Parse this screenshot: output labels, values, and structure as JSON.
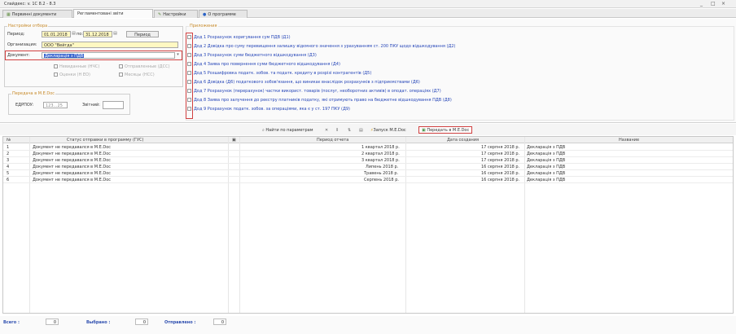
{
  "window": {
    "title": "Слайдекс: v. 1С 8.2 - 8.3",
    "controls": [
      "_",
      "□",
      "×"
    ]
  },
  "tabs": [
    {
      "label": "Первинні документи",
      "icon": "grid-icon",
      "active": false
    },
    {
      "label": "Регламентовані звіти",
      "icon": "",
      "active": true
    },
    {
      "label": "Настройки",
      "icon": "settings-icon",
      "active": false
    },
    {
      "label": "О программе",
      "icon": "info-icon",
      "active": false
    }
  ],
  "filter": {
    "group_title": "Настройки отбора",
    "period_label": "Период:",
    "period_from": "01.01.2018",
    "period_to_label": "по:",
    "period_to": "31.12.2018",
    "period_button": "Период",
    "org_label": "Организация:",
    "org_value": "ООО \"Вейгда\"",
    "doc_label": "Документ:",
    "doc_value": "Декларація з ПДВ",
    "opt1": "Невиданные (НЧС)",
    "opt2": "Отправленные (ДСС)",
    "opt3": "Оценки (Н ЕО)",
    "opt4": "Месяцы (НСС)"
  },
  "transfer": {
    "group_title": "Передача в M.E.Doc",
    "edrpou_label": "ЕДРПОУ:",
    "edrpou_value": "123…25",
    "period_label": "Звітний:"
  },
  "appendices": {
    "group_title": "Приложения",
    "items": [
      "Дод 1 Розрахунок коригування сум ПДВ (Д1)",
      "Дод 2 Довідка про суму перевищення залишку вiдємного значення з урахуванням ст. 200 ПКУ щодо відшкодування (Д2)",
      "Дод 3 Розрахунок суми бюджетного відшкодування (Д3)",
      "Дод 4 Заява про повернення суми бюджетного відшкодування (Д4)",
      "Дод 5 Розшифровка податк. зобов. та податк. кредиту в розрізі контрагентів (Д5)",
      "Дод 6 Довідка (Д6) податкового зобов'язання, що виникає внаслідок розрахунків з підприємствами (Д6)",
      "Дод 7 Розрахунок (перерахунок) частки використ. товарів (послуг, необоротних активів) в оподат. операціях (Д7)",
      "Дод 8 Заява про залучення до реєстру платників податку, які отримують право на бюджетне відшкодування ПДВ (Д8)",
      "Дод 9 Розрахунок податк. зобов. за операціями, яка є у ст. 197 ПКУ (Д9)"
    ]
  },
  "toolbar": {
    "find": "Найти по параметрам",
    "send": "Запуск M.E.Doc",
    "transfer": "Передать в M.E.Doc"
  },
  "grid": {
    "columns": [
      "№",
      "Статус отправки в программу (ГУС)",
      "",
      "Период отчета",
      "Дата создания",
      "Название"
    ],
    "rows": [
      {
        "n": "1",
        "status": "Документ не передавался в M.E.Doc",
        "period": "1 квартал 2018 р.",
        "date": "17 серпня 2018 р.",
        "name": "Декларація з ПДВ"
      },
      {
        "n": "2",
        "status": "Документ не передавался в M.E.Doc",
        "period": "2 квартал 2018 р.",
        "date": "17 серпня 2018 р.",
        "name": "Декларація з ПДВ"
      },
      {
        "n": "3",
        "status": "Документ не передавался в M.E.Doc",
        "period": "3 квартал 2018 р.",
        "date": "17 серпня 2018 р.",
        "name": "Декларація з ПДВ"
      },
      {
        "n": "4",
        "status": "Документ не передавался в M.E.Doc",
        "period": "Липень 2018 р.",
        "date": "16 серпня 2018 р.",
        "name": "Декларація з ПДВ"
      },
      {
        "n": "5",
        "status": "Документ не передавался в M.E.Doc",
        "period": "Травень 2018 р.",
        "date": "16 серпня 2018 р.",
        "name": "Декларація з ПДВ"
      },
      {
        "n": "6",
        "status": "Документ не передавался в M.E.Doc",
        "period": "Серпень 2018 р.",
        "date": "16 серпня 2018 р.",
        "name": "Декларація з ПДВ"
      }
    ]
  },
  "footer": {
    "total_label": "Всего :",
    "total_value": "0",
    "selected_label": "Выбрано :",
    "selected_value": "0",
    "sent_label": "Отправлено :",
    "sent_value": "0"
  },
  "colors": {
    "accent": "#c78a2a",
    "highlight": "#d04040",
    "link": "#2646b8",
    "selection": "#3a66d0"
  }
}
